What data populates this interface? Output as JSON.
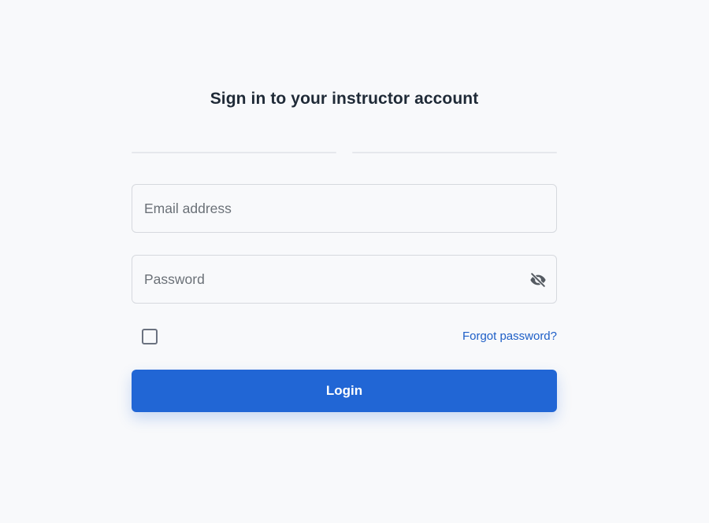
{
  "form": {
    "title": "Sign in to your instructor account",
    "email_placeholder": "Email address",
    "email_value": "",
    "password_placeholder": "Password",
    "password_value": "",
    "password_toggle_icon": "eye-slash-icon",
    "remember_checked": false,
    "forgot_label": "Forgot password?",
    "login_label": "Login"
  },
  "colors": {
    "background": "#f8f9fb",
    "primary": "#2166d5",
    "link": "#1e5fc7",
    "title": "#1f2a37",
    "border": "#d6d9de"
  }
}
